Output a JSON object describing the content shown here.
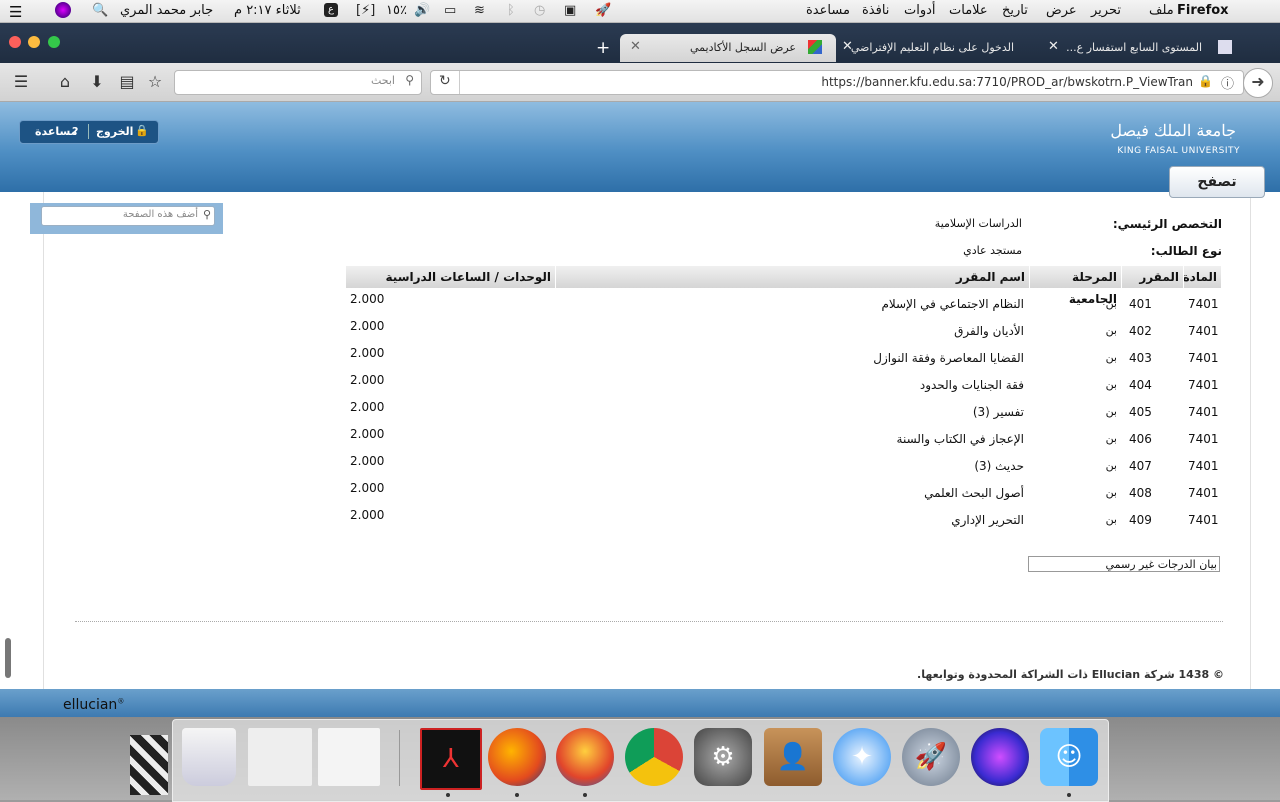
{
  "menubar": {
    "app": "Firefox",
    "items": [
      "ملف",
      "تحرير",
      "عرض",
      "تاريخ",
      "علامات",
      "أدوات",
      "نافذة",
      "مساعدة"
    ],
    "user": "جابر محمد المري",
    "clock": "ثلاثاء ٢:١٧ م",
    "battery": "١٥٪",
    "input_lang": "ع"
  },
  "tabs": [
    {
      "label": "عرض السجل الأكاديمي",
      "active": true
    },
    {
      "label": "الدخول على نظام التعليم الإفتراضي",
      "active": false
    },
    {
      "label": "المستوى السابع استفسار ع...",
      "active": false
    }
  ],
  "toolbar": {
    "search_placeholder": "ابحث",
    "url": "https://banner.kfu.edu.sa:7710/PROD_ar/bwskotrn.P_ViewTran"
  },
  "header": {
    "university_ar": "جامعة الملك فيصل",
    "university_en": "KING FAISAL UNIVERSITY",
    "logout": "الخروج",
    "help": "مساعدة",
    "nav": "تصفح"
  },
  "add_page_placeholder": "أضف هذه الصفحة",
  "student": {
    "major_label": "التخصص الرئيسي:",
    "major_value": "الدراسات الإسلامية",
    "type_label": "نوع الطالب:",
    "type_value": "مستجد عادي"
  },
  "table": {
    "headers": [
      "المادة",
      "المقرر",
      "المرحلة الجامعية",
      "اسم المقرر",
      "الوحدات / الساعات الدراسية"
    ],
    "rows": [
      {
        "subject": "7401",
        "course": "401",
        "level": "بن",
        "name": "النظام الاجتماعي في الإسلام",
        "hours": "2.000"
      },
      {
        "subject": "7401",
        "course": "402",
        "level": "بن",
        "name": "الأديان والفرق",
        "hours": "2.000"
      },
      {
        "subject": "7401",
        "course": "403",
        "level": "بن",
        "name": "القضايا المعاصرة وفقة النوازل",
        "hours": "2.000"
      },
      {
        "subject": "7401",
        "course": "404",
        "level": "بن",
        "name": "فقة الجنايات والحدود",
        "hours": "2.000"
      },
      {
        "subject": "7401",
        "course": "405",
        "level": "بن",
        "name": "تفسير (3)",
        "hours": "2.000"
      },
      {
        "subject": "7401",
        "course": "406",
        "level": "بن",
        "name": "الإعجاز في الكتاب والسنة",
        "hours": "2.000"
      },
      {
        "subject": "7401",
        "course": "407",
        "level": "بن",
        "name": "حديث (3)",
        "hours": "2.000"
      },
      {
        "subject": "7401",
        "course": "408",
        "level": "بن",
        "name": "أصول البحث العلمي",
        "hours": "2.000"
      },
      {
        "subject": "7401",
        "course": "409",
        "level": "بن",
        "name": "التحرير الإداري",
        "hours": "2.000"
      }
    ]
  },
  "unofficial_select": "بيان الدرجات غير رسمي",
  "copyright": "© 1438 شركة Ellucian ذات الشراكة المحدودة وتوابعها.",
  "footer_brand": "ellucian",
  "colors": {
    "header_blue": "#4f8fc4",
    "footer_blue": "#3d7ab1"
  }
}
